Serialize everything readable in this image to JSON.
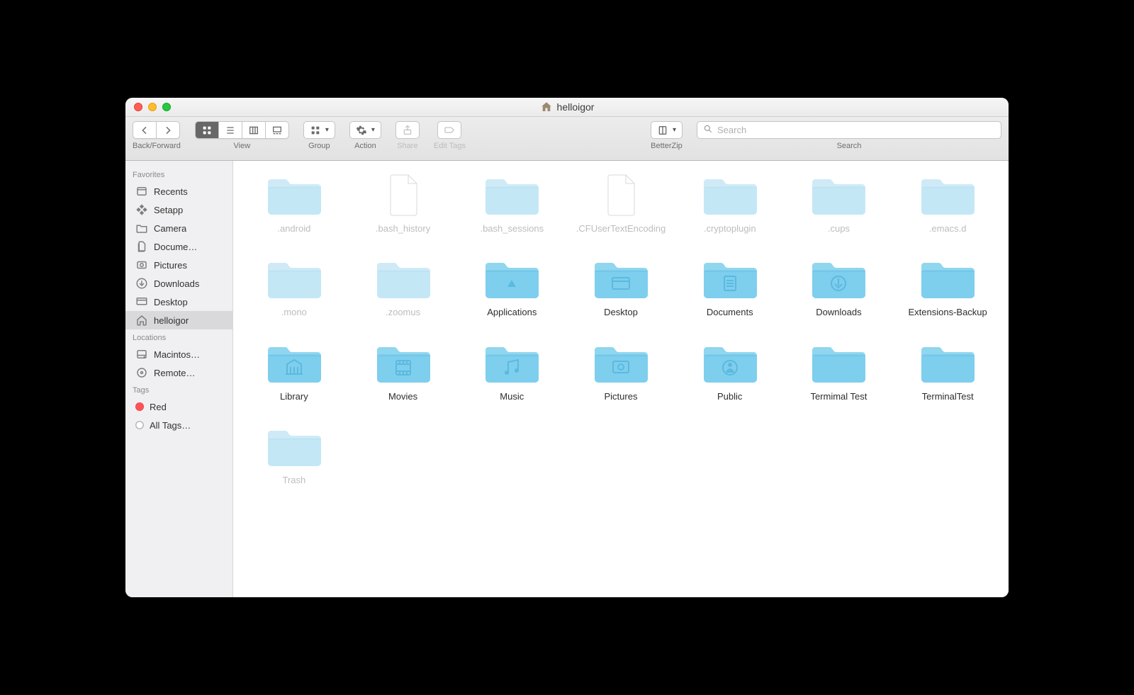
{
  "window": {
    "title": "helloigor"
  },
  "toolbar": {
    "back_forward_label": "Back/Forward",
    "view_label": "View",
    "group_label": "Group",
    "action_label": "Action",
    "share_label": "Share",
    "edit_tags_label": "Edit Tags",
    "betterzip_label": "BetterZip",
    "search_label": "Search",
    "search_placeholder": "Search"
  },
  "sidebar": {
    "sections": {
      "favorites": {
        "title": "Favorites",
        "items": [
          {
            "label": "Recents",
            "icon": "recents"
          },
          {
            "label": "Setapp",
            "icon": "setapp"
          },
          {
            "label": "Camera",
            "icon": "folder"
          },
          {
            "label": "Docume…",
            "icon": "documents"
          },
          {
            "label": "Pictures",
            "icon": "pictures"
          },
          {
            "label": "Downloads",
            "icon": "downloads"
          },
          {
            "label": "Desktop",
            "icon": "desktop"
          },
          {
            "label": "helloigor",
            "icon": "home",
            "selected": true
          }
        ]
      },
      "locations": {
        "title": "Locations",
        "items": [
          {
            "label": "Macintos…",
            "icon": "hdd"
          },
          {
            "label": "Remote…",
            "icon": "disc"
          }
        ]
      },
      "tags": {
        "title": "Tags",
        "items": [
          {
            "label": "Red",
            "color": "red"
          },
          {
            "label": "All Tags…",
            "color": "gray"
          }
        ]
      }
    }
  },
  "items": [
    {
      "name": ".android",
      "type": "folder",
      "hidden": true,
      "glyph": "none"
    },
    {
      "name": ".bash_history",
      "type": "file",
      "hidden": true,
      "glyph": "none"
    },
    {
      "name": ".bash_sessions",
      "type": "folder",
      "hidden": true,
      "glyph": "none"
    },
    {
      "name": ".CFUserTextEncoding",
      "type": "file",
      "hidden": true,
      "glyph": "none"
    },
    {
      "name": ".cryptoplugin",
      "type": "folder",
      "hidden": true,
      "glyph": "none"
    },
    {
      "name": ".cups",
      "type": "folder",
      "hidden": true,
      "glyph": "none"
    },
    {
      "name": ".emacs.d",
      "type": "folder",
      "hidden": true,
      "glyph": "none"
    },
    {
      "name": ".mono",
      "type": "folder",
      "hidden": true,
      "glyph": "none"
    },
    {
      "name": ".zoomus",
      "type": "folder",
      "hidden": true,
      "glyph": "none"
    },
    {
      "name": "Applications",
      "type": "folder",
      "hidden": false,
      "glyph": "apps"
    },
    {
      "name": "Desktop",
      "type": "folder",
      "hidden": false,
      "glyph": "desktop"
    },
    {
      "name": "Documents",
      "type": "folder",
      "hidden": false,
      "glyph": "documents"
    },
    {
      "name": "Downloads",
      "type": "folder",
      "hidden": false,
      "glyph": "downloads"
    },
    {
      "name": "Extensions-Backup",
      "type": "folder",
      "hidden": false,
      "glyph": "none"
    },
    {
      "name": "Library",
      "type": "folder",
      "hidden": false,
      "glyph": "library"
    },
    {
      "name": "Movies",
      "type": "folder",
      "hidden": false,
      "glyph": "movies"
    },
    {
      "name": "Music",
      "type": "folder",
      "hidden": false,
      "glyph": "music"
    },
    {
      "name": "Pictures",
      "type": "folder",
      "hidden": false,
      "glyph": "pictures"
    },
    {
      "name": "Public",
      "type": "folder",
      "hidden": false,
      "glyph": "public"
    },
    {
      "name": "Termimal Test",
      "type": "folder",
      "hidden": false,
      "glyph": "none"
    },
    {
      "name": "TerminalTest",
      "type": "folder",
      "hidden": false,
      "glyph": "none"
    },
    {
      "name": "Trash",
      "type": "folder",
      "hidden": true,
      "glyph": "none"
    }
  ]
}
